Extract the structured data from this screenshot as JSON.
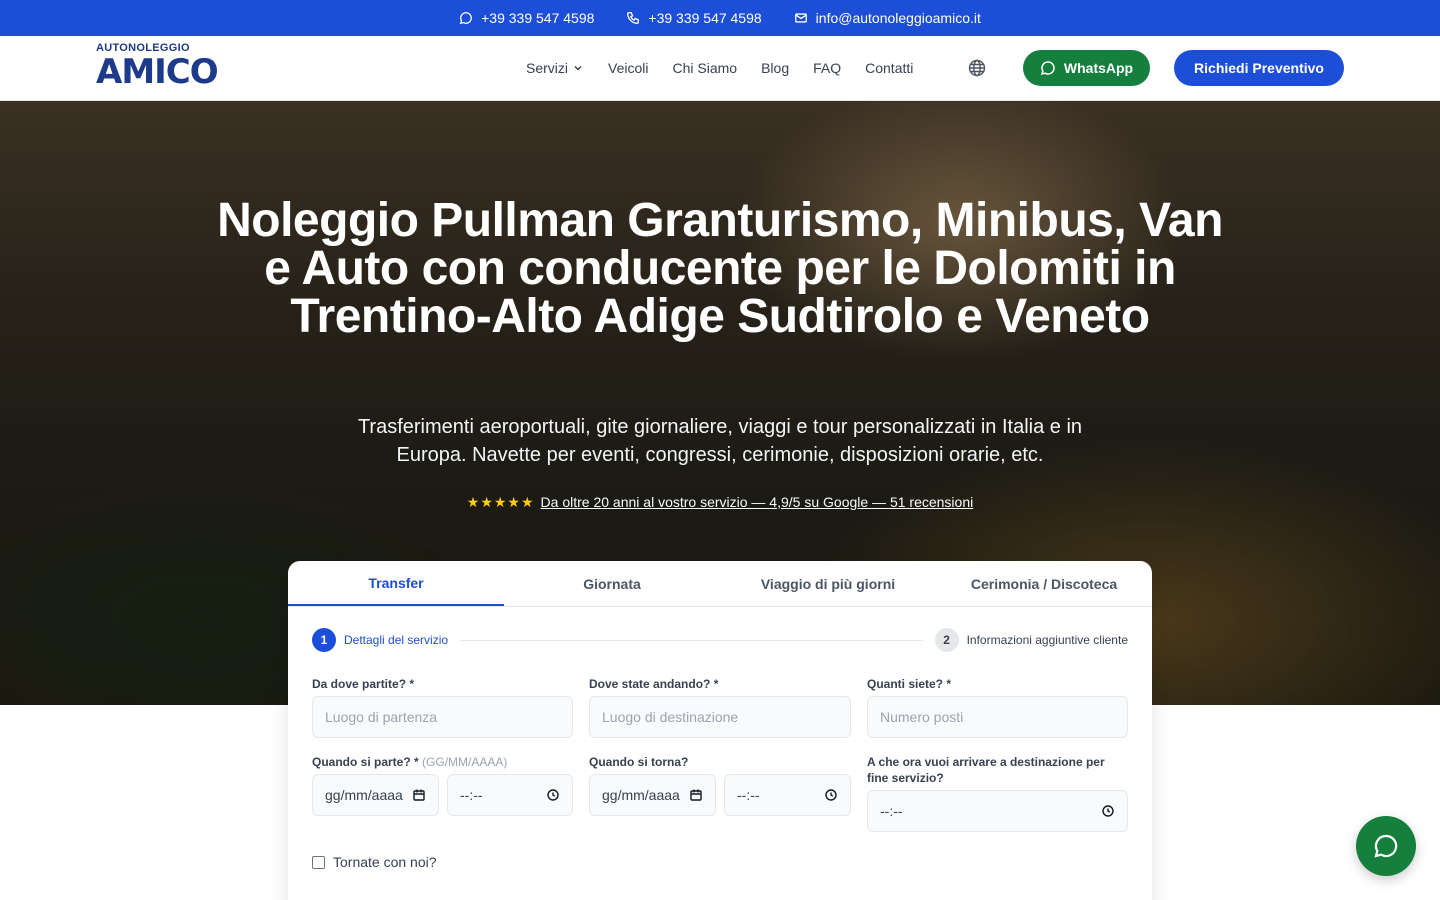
{
  "topbar": {
    "whatsapp": "+39 339 547 4598",
    "phone": "+39 339 547 4598",
    "email": "info@autonoleggioamico.it"
  },
  "logo": {
    "line1": "AUTONOLEGGIO",
    "line2": "AMICO"
  },
  "nav": {
    "items": [
      "Servizi",
      "Veicoli",
      "Chi Siamo",
      "Blog",
      "FAQ",
      "Contatti"
    ],
    "whatsapp_label": "WhatsApp",
    "quote_label": "Richiedi Preventivo"
  },
  "hero": {
    "title": "Noleggio Pullman Granturismo, Minibus, Van e Auto con conducente per le Dolomiti in Trentino-Alto Adige Sudtirolo e Veneto",
    "subtitle": "Trasferimenti aeroportuali, gite giornaliere, viaggi e tour personalizzati in Italia e in Europa. Navette per eventi, congressi, cerimonie, disposizioni orarie, etc.",
    "stars": "★★★★★",
    "rating_text": "Da oltre 20 anni al vostro servizio — 4,9/5 su Google — 51 recensioni"
  },
  "form": {
    "tabs": [
      "Transfer",
      "Giornata",
      "Viaggio di più giorni",
      "Cerimonia / Discoteca"
    ],
    "active_tab": "Transfer",
    "steps": [
      {
        "num": "1",
        "label": "Dettagli del servizio"
      },
      {
        "num": "2",
        "label": "Informazioni aggiuntive cliente"
      }
    ],
    "from_label": "Da dove partite? *",
    "from_placeholder": "Luogo di partenza",
    "to_label": "Dove state andando? *",
    "to_placeholder": "Luogo di destinazione",
    "people_label": "Quanti siete? *",
    "people_placeholder": "Numero posti",
    "depart_label": "Quando si parte? *",
    "depart_hint": "(GG/MM/AAAA)",
    "date_placeholder": "gg/mm/aaaa",
    "time_placeholder": "--:--",
    "return_label": "Quando si torna?",
    "arrive_label": "A che ora vuoi arrivare a destinazione per fine servizio?",
    "return_checkbox": "Tornate con noi?"
  },
  "colors": {
    "brand": "#1d4ed8",
    "whatsapp": "#15803d"
  }
}
